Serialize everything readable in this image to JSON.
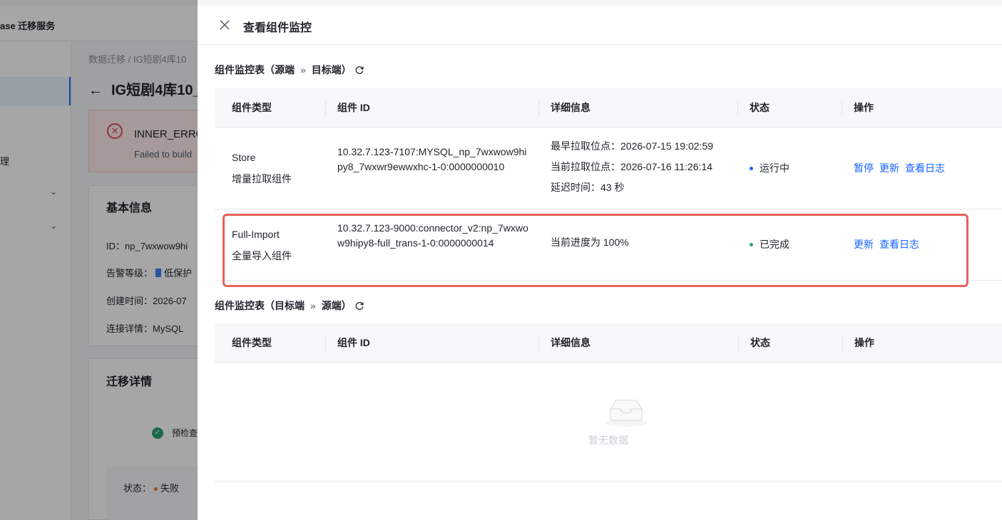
{
  "background": {
    "brand": "ase 迁移服务",
    "breadcrumb": "数据迁移 / IG短剧4库10",
    "page_title": "IG短剧4库10_",
    "sidebar_label": "理",
    "error": {
      "code": "INNER_ERRO",
      "message": "Failed to build"
    },
    "basic_info": {
      "title": "基本信息",
      "id_line": "ID：np_7wxwow9hi",
      "alert_label": "告警等级：",
      "alert_value": "低保护",
      "created_line": "创建时间：2026-07",
      "connection_line": "连接详情：MySQL"
    },
    "migration": {
      "title": "迁移详情",
      "precheck": "预检查",
      "status_label": "状态：",
      "status_value": "失败"
    }
  },
  "drawer": {
    "title": "查看组件监控",
    "section1": {
      "prefix": "组件监控表（源端",
      "arrow": "»",
      "suffix": "目标端）"
    },
    "section2": {
      "prefix": "组件监控表（目标端",
      "arrow": "»",
      "suffix": "源端）"
    },
    "columns": [
      "组件类型",
      "组件 ID",
      "详细信息",
      "状态",
      "操作"
    ],
    "rows": [
      {
        "type_name": "Store",
        "type_desc": "增量拉取组件",
        "id": "10.32.7.123-7107:MYSQL_np_7wxwow9hipy8_7wxwr9ewwxhc-1-0:0000000010",
        "details": [
          "最早拉取位点：2026-07-15 19:02:59",
          "当前拉取位点：2026-07-16 11:26:14",
          "延迟时间：43 秒"
        ],
        "status": "运行中",
        "status_color": "#1664ff",
        "actions": [
          "暂停",
          "更新",
          "查看日志"
        ]
      },
      {
        "type_name": "Full-Import",
        "type_desc": "全量导入组件",
        "id": "10.32.7.123-9000:connector_v2:np_7wxwow9hipy8-full_trans-1-0:0000000014",
        "details": [
          "当前进度为 100%"
        ],
        "status": "已完成",
        "status_color": "#2ba471",
        "actions": [
          "更新",
          "查看日志"
        ]
      }
    ],
    "empty_text": "暂无数据"
  }
}
